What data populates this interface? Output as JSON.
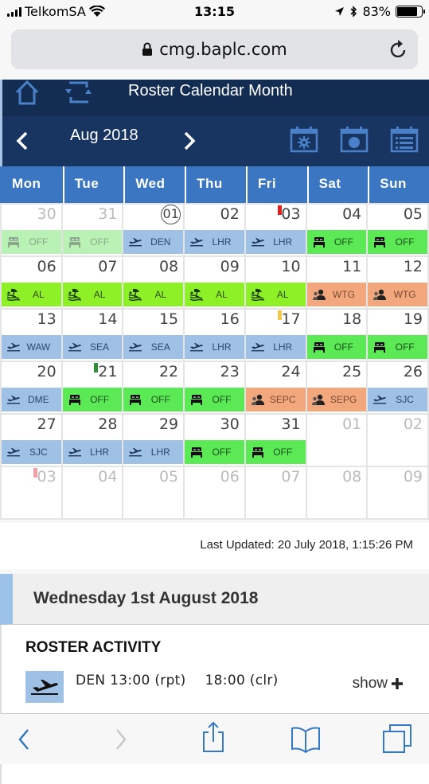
{
  "status_bar": {
    "carrier": "TelkomSA",
    "time": "13:15",
    "battery_percent": "83%",
    "battery_level": 0.83
  },
  "browser": {
    "url": "cmg.baplc.com"
  },
  "header": {
    "title": "Roster Calendar Month",
    "month_label": "Aug 2018"
  },
  "weekdays": [
    "Mon",
    "Tue",
    "Wed",
    "Thu",
    "Fri",
    "Sat",
    "Sun"
  ],
  "colors": {
    "flight": "#9fc1e5",
    "off": "#5bea55",
    "annual_leave": "#8ef128",
    "standby": "#f2a77d",
    "header_dark": "#132c52",
    "weekday_bar": "#3b76c2"
  },
  "calendar": {
    "days": [
      {
        "day": "30",
        "faded": true,
        "duty": {
          "type": "off-faded",
          "icon": "bed-icon",
          "label": "OFF"
        }
      },
      {
        "day": "31",
        "faded": true,
        "duty": {
          "type": "off-faded",
          "icon": "bed-icon",
          "label": "OFF"
        }
      },
      {
        "day": "01",
        "today": true,
        "duty": {
          "type": "flight",
          "icon": "plane-icon",
          "label": "DEN"
        }
      },
      {
        "day": "02",
        "duty": {
          "type": "flight",
          "icon": "plane-icon",
          "label": "LHR"
        }
      },
      {
        "day": "03",
        "flag": "#e02020",
        "duty": {
          "type": "flight",
          "icon": "plane-icon",
          "label": "LHR"
        }
      },
      {
        "day": "04",
        "duty": {
          "type": "off",
          "icon": "bed-icon",
          "label": "OFF"
        }
      },
      {
        "day": "05",
        "duty": {
          "type": "off",
          "icon": "bed-icon",
          "label": "OFF"
        }
      },
      {
        "day": "06",
        "duty": {
          "type": "al",
          "icon": "beach-icon",
          "label": "AL"
        }
      },
      {
        "day": "07",
        "duty": {
          "type": "al",
          "icon": "beach-icon",
          "label": "AL"
        }
      },
      {
        "day": "08",
        "duty": {
          "type": "al",
          "icon": "beach-icon",
          "label": "AL"
        }
      },
      {
        "day": "09",
        "duty": {
          "type": "al",
          "icon": "beach-icon",
          "label": "AL"
        }
      },
      {
        "day": "10",
        "duty": {
          "type": "al",
          "icon": "beach-icon",
          "label": "AL"
        }
      },
      {
        "day": "11",
        "duty": {
          "type": "wtg",
          "icon": "people-icon",
          "label": "WTG"
        }
      },
      {
        "day": "12",
        "duty": {
          "type": "wtg",
          "icon": "people-icon",
          "label": "WTG"
        }
      },
      {
        "day": "13",
        "duty": {
          "type": "flight",
          "icon": "plane-icon",
          "label": "WAW"
        }
      },
      {
        "day": "14",
        "duty": {
          "type": "flight",
          "icon": "plane-icon",
          "label": "SEA"
        }
      },
      {
        "day": "15",
        "duty": {
          "type": "flight",
          "icon": "plane-icon",
          "label": "SEA"
        }
      },
      {
        "day": "16",
        "duty": {
          "type": "flight",
          "icon": "plane-icon",
          "label": "LHR"
        }
      },
      {
        "day": "17",
        "flag": "#f2c84a",
        "duty": {
          "type": "flight",
          "icon": "plane-icon",
          "label": "LHR"
        }
      },
      {
        "day": "18",
        "duty": {
          "type": "off",
          "icon": "bed-icon",
          "label": "OFF"
        }
      },
      {
        "day": "19",
        "duty": {
          "type": "off",
          "icon": "bed-icon",
          "label": "OFF"
        }
      },
      {
        "day": "20",
        "duty": {
          "type": "flight",
          "icon": "plane-icon",
          "label": "DME"
        }
      },
      {
        "day": "21",
        "flag": "#2f8f3a",
        "duty": {
          "type": "off",
          "icon": "bed-icon",
          "label": "OFF"
        }
      },
      {
        "day": "22",
        "duty": {
          "type": "off",
          "icon": "bed-icon",
          "label": "OFF"
        }
      },
      {
        "day": "23",
        "duty": {
          "type": "off",
          "icon": "bed-icon",
          "label": "OFF"
        }
      },
      {
        "day": "24",
        "duty": {
          "type": "wtg",
          "icon": "people-icon",
          "label": "SEPC"
        }
      },
      {
        "day": "25",
        "duty": {
          "type": "wtg",
          "icon": "people-icon",
          "label": "SEPG"
        }
      },
      {
        "day": "26",
        "duty": {
          "type": "flight",
          "icon": "plane-icon",
          "label": "SJC"
        }
      },
      {
        "day": "27",
        "duty": {
          "type": "flight",
          "icon": "plane-icon",
          "label": "SJC"
        }
      },
      {
        "day": "28",
        "duty": {
          "type": "flight",
          "icon": "plane-icon",
          "label": "LHR"
        }
      },
      {
        "day": "29",
        "duty": {
          "type": "flight",
          "icon": "plane-icon",
          "label": "LHR"
        }
      },
      {
        "day": "30",
        "duty": {
          "type": "off",
          "icon": "bed-icon",
          "label": "OFF"
        }
      },
      {
        "day": "31",
        "duty": {
          "type": "off",
          "icon": "bed-icon",
          "label": "OFF"
        }
      },
      {
        "day": "01",
        "faded": true
      },
      {
        "day": "02",
        "faded": true
      },
      {
        "day": "03",
        "faded": true,
        "flag": "#f2a0a8"
      },
      {
        "day": "04",
        "faded": true
      },
      {
        "day": "05",
        "faded": true
      },
      {
        "day": "06",
        "faded": true
      },
      {
        "day": "07",
        "faded": true
      },
      {
        "day": "08",
        "faded": true
      },
      {
        "day": "09",
        "faded": true
      }
    ]
  },
  "last_updated": "Last Updated: 20 July 2018, 1:15:26 PM",
  "selected_day": {
    "title": "Wednesday 1st August 2018",
    "section_heading": "ROSTER ACTIVITY",
    "activity": {
      "icon": "plane-icon",
      "report": "DEN 13:00 (rpt)",
      "clear": "18:00 (clr)",
      "show_label": "show"
    }
  }
}
